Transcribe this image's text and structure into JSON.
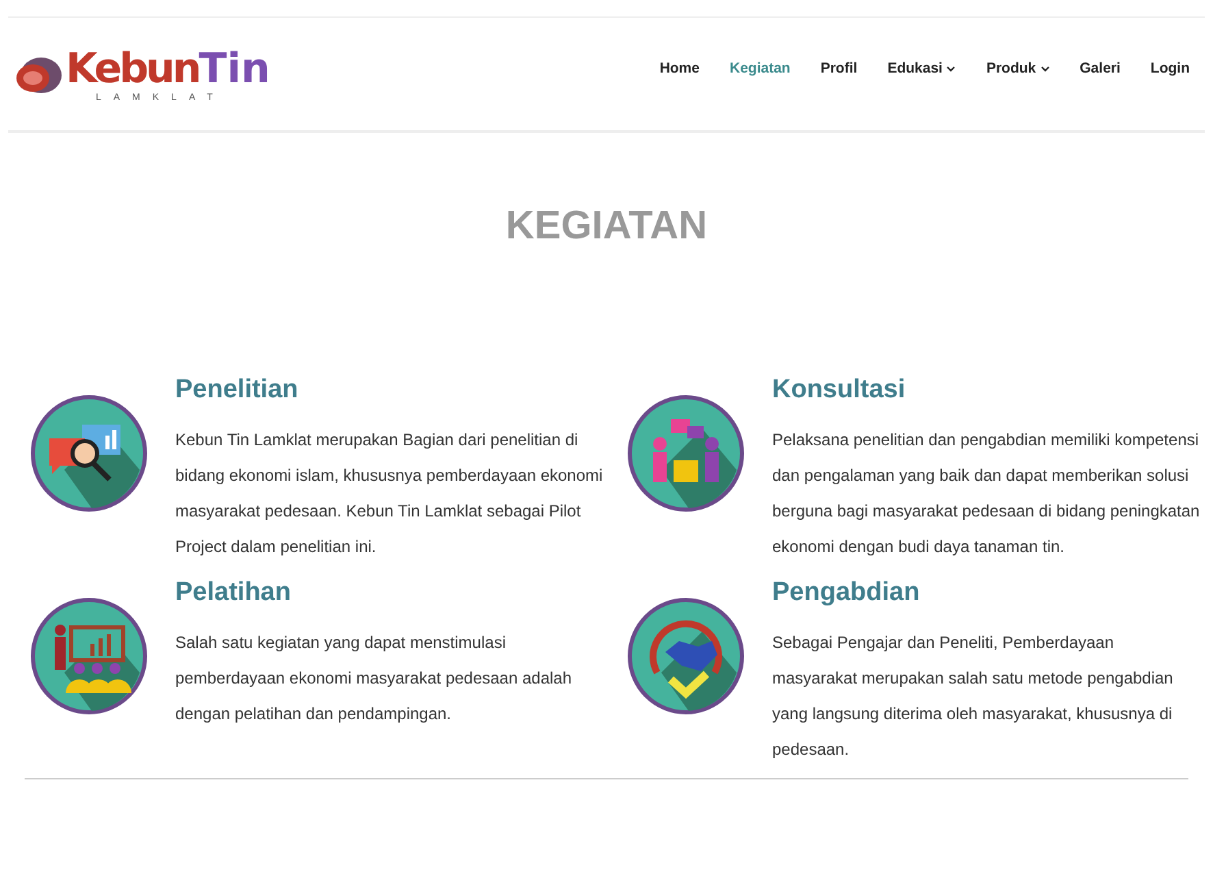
{
  "logo": {
    "word_1": "Kebun",
    "word_2": "Tin",
    "tagline": "LAMKLAT"
  },
  "nav": [
    {
      "label": "Home",
      "selected": false,
      "dropdown": false
    },
    {
      "label": "Kegiatan",
      "selected": true,
      "dropdown": false
    },
    {
      "label": "Profil",
      "selected": false,
      "dropdown": false
    },
    {
      "label": "Edukasi",
      "selected": false,
      "dropdown": true
    },
    {
      "label": "Produk",
      "selected": false,
      "dropdown": true
    },
    {
      "label": "Galeri",
      "selected": false,
      "dropdown": false
    },
    {
      "label": "Login",
      "selected": false,
      "dropdown": false
    }
  ],
  "heading": "KEGIATAN",
  "columns": [
    [
      {
        "kind": "research",
        "title": "Penelitian",
        "text": "Kebun Tin Lamklat merupakan Bagian dari penelitian di bidang ekonomi islam, khususnya pemberdayaan ekonomi masyarakat pedesaan. Kebun Tin Lamklat sebagai Pilot Project dalam penelitian ini."
      },
      {
        "kind": "training",
        "title": "Pelatihan",
        "text": "Salah satu kegiatan yang dapat menstimulasi pemberdayaan ekonomi masyarakat pedesaan adalah dengan pelatihan dan pendampingan."
      }
    ],
    [
      {
        "kind": "consult",
        "title": "Konsultasi",
        "text": "Pelaksana penelitian dan pengabdian memiliki kompetensi dan pengalaman yang baik dan dapat memberikan solusi berguna bagi masyarakat pedesaan di bidang peningkatan ekonomi dengan budi daya tanaman tin."
      },
      {
        "kind": "service",
        "title": "Pengabdian",
        "text": "Sebagai Pengajar dan Peneliti, Pemberdayaan masyarakat merupakan salah satu metode pengabdian yang langsung diterima oleh masyarakat, khususnya di pedesaan."
      }
    ]
  ]
}
